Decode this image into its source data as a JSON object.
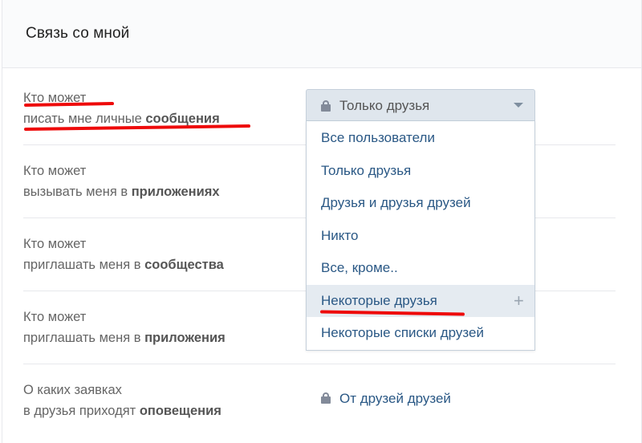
{
  "header": {
    "title": "Связь со мной"
  },
  "rows": [
    {
      "line1": "Кто может",
      "line2_prefix": "писать мне личные ",
      "line2_bold": "сообщения"
    },
    {
      "line1": "Кто может",
      "line2_prefix": "вызывать меня в ",
      "line2_bold": "приложениях"
    },
    {
      "line1": "Кто может",
      "line2_prefix": "приглашать меня в ",
      "line2_bold": "сообщества"
    },
    {
      "line1": "Кто может",
      "line2_prefix": "приглашать меня в ",
      "line2_bold": "приложения"
    },
    {
      "line1": "О каких заявках",
      "line2_prefix": "в друзья приходят ",
      "line2_bold": "оповещения"
    }
  ],
  "select": {
    "value": "Только друзья",
    "icon": "lock-icon"
  },
  "dropdown": {
    "options": [
      "Все пользователи",
      "Только друзья",
      "Друзья и друзья друзей",
      "Никто",
      "Все, кроме..",
      "Некоторые друзья",
      "Некоторые списки друзей"
    ],
    "highlighted_index": 5,
    "highlight_icon": "plus-icon"
  },
  "bottom_value": {
    "text": "От друзей друзей",
    "icon": "lock-icon"
  },
  "colors": {
    "link": "#2a5885",
    "annotation": "#ee0a0a",
    "highlight": "#e5ebf1"
  }
}
